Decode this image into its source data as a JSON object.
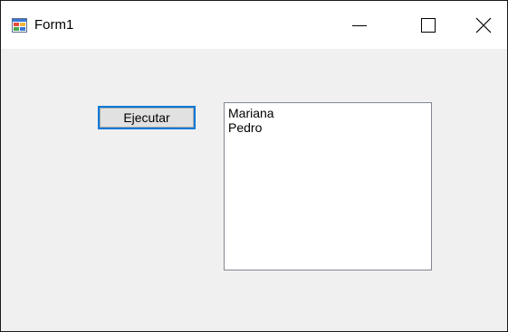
{
  "window": {
    "title": "Form1",
    "caption_buttons": {
      "minimize_icon": "minimize-icon",
      "maximize_icon": "maximize-icon",
      "close_icon": "close-icon"
    }
  },
  "form": {
    "execute_button_label": "Ejecutar",
    "listbox_items": [
      "Mariana",
      "Pedro"
    ]
  },
  "colors": {
    "focus_border": "#0078d7",
    "client_background": "#f0f0f0"
  }
}
